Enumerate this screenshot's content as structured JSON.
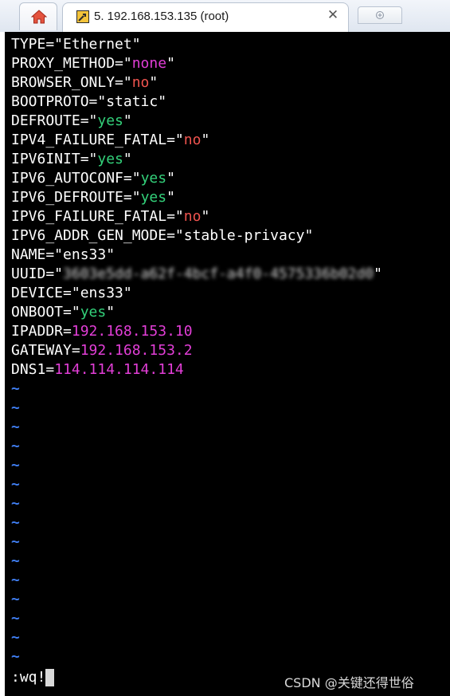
{
  "tabs": {
    "home_icon": "home-icon",
    "session_icon": "terminal-tool-icon",
    "session_title": "5. 192.168.153.135 (root)",
    "close_icon": "close-icon",
    "close_glyph": "✕",
    "new_tab_icon": "new-tab-icon"
  },
  "colors": {
    "terminal_bg": "#000000",
    "text": "#ffffff",
    "value_magenta": "#e23ed7",
    "value_red": "#f0544f",
    "value_green": "#33d17a",
    "tilde_blue": "#3f7df0"
  },
  "editor": {
    "lines": [
      {
        "text": "TYPE=\"Ethernet\""
      },
      {
        "pre": "PROXY_METHOD=\"",
        "val": "none",
        "post": "\""
      },
      {
        "pre": "BROWSER_ONLY=\"",
        "val": "no",
        "post": "\""
      },
      {
        "text": "BOOTPROTO=\"static\""
      },
      {
        "pre": "DEFROUTE=\"",
        "val": "yes",
        "post": "\""
      },
      {
        "pre": "IPV4_FAILURE_FATAL=\"",
        "val": "no",
        "post": "\""
      },
      {
        "pre": "IPV6INIT=\"",
        "val": "yes",
        "post": "\""
      },
      {
        "pre": "IPV6_AUTOCONF=\"",
        "val": "yes",
        "post": "\""
      },
      {
        "pre": "IPV6_DEFROUTE=\"",
        "val": "yes",
        "post": "\""
      },
      {
        "pre": "IPV6_FAILURE_FATAL=\"",
        "val": "no",
        "post": "\""
      },
      {
        "text": "IPV6_ADDR_GEN_MODE=\"stable-privacy\""
      },
      {
        "text": "NAME=\"ens33\""
      },
      {
        "pre": "UUID=\"",
        "val": "3603e5dd-a62f-4bcf-a4f0-4575336b02d0",
        "post": "\""
      },
      {
        "text": "DEVICE=\"ens33\""
      },
      {
        "pre": "ONBOOT=\"",
        "val": "yes",
        "post": "\""
      },
      {
        "pre": "IPADDR=",
        "val": "192.168.153.10",
        "post": ""
      },
      {
        "pre": "GATEWAY=",
        "val": "192.168.153.2",
        "post": ""
      },
      {
        "pre": "DNS1=",
        "val": "114.114.114.114",
        "post": ""
      }
    ],
    "tilde": "~",
    "tilde_count": 15,
    "command": ":wq!"
  },
  "watermark": "CSDN @关键还得世俗"
}
